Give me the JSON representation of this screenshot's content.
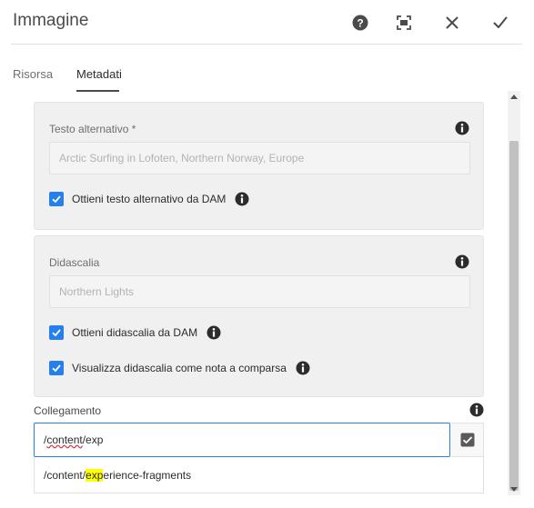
{
  "dialog": {
    "title": "Immagine"
  },
  "header_actions": [
    {
      "name": "help-icon"
    },
    {
      "name": "fullscreen-icon"
    },
    {
      "name": "close-icon"
    },
    {
      "name": "done-icon"
    }
  ],
  "tabs": [
    {
      "label": "Risorsa",
      "active": false
    },
    {
      "label": "Metadati",
      "active": true
    }
  ],
  "alt_section": {
    "label": "Testo alternativo *",
    "placeholder": "Arctic Surfing in Lofoten, Northern Norway, Europe",
    "checkbox_label": "Ottieni testo alternativo da DAM",
    "checked": true
  },
  "caption_section": {
    "label": "Didascalia",
    "placeholder": "Northern Lights",
    "checkbox1_label": "Ottieni didascalia da DAM",
    "checkbox1_checked": true,
    "checkbox2_label": "Visualizza didascalia come nota a comparsa",
    "checkbox2_checked": true
  },
  "link_section": {
    "label": "Collegamento",
    "value_prefix": "/",
    "value_squiggle": "content",
    "value_suffix": "/exp",
    "suggestion_prefix": "/content/",
    "suggestion_highlight": "exp",
    "suggestion_suffix": "erience-fragments"
  },
  "colors": {
    "accent": "#2680eb",
    "panel_bg": "#f0f0f0",
    "highlight": "#ffff00"
  }
}
